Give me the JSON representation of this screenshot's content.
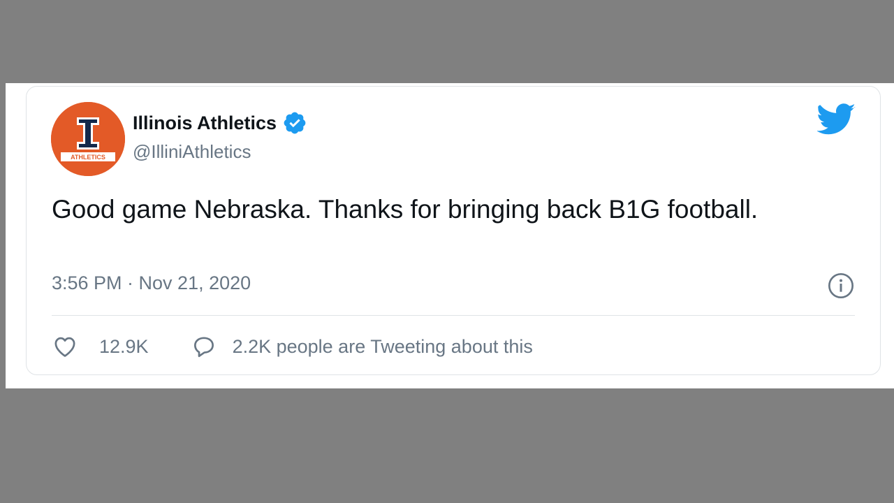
{
  "tweet": {
    "avatar": {
      "letter": "I",
      "text": "ATHLETICS",
      "color": "#e35a27",
      "dark_color": "#13294b"
    },
    "display_name": "Illinois Athletics",
    "verified": true,
    "handle": "@IlliniAthletics",
    "text": "Good game Nebraska. Thanks for bringing back B1G football.",
    "timestamp": "3:56 PM · Nov 21, 2020",
    "likes": "12.9K",
    "conversation": "2.2K people are Tweeting about this",
    "icons": {
      "brand": "twitter-bird-icon",
      "verified": "verified-badge-icon",
      "info": "info-icon",
      "like": "heart-icon",
      "reply": "speech-bubble-icon"
    },
    "colors": {
      "brand_blue": "#1d9bf0",
      "text": "#0f1419",
      "muted": "#687684",
      "page_background": "#808080"
    }
  }
}
